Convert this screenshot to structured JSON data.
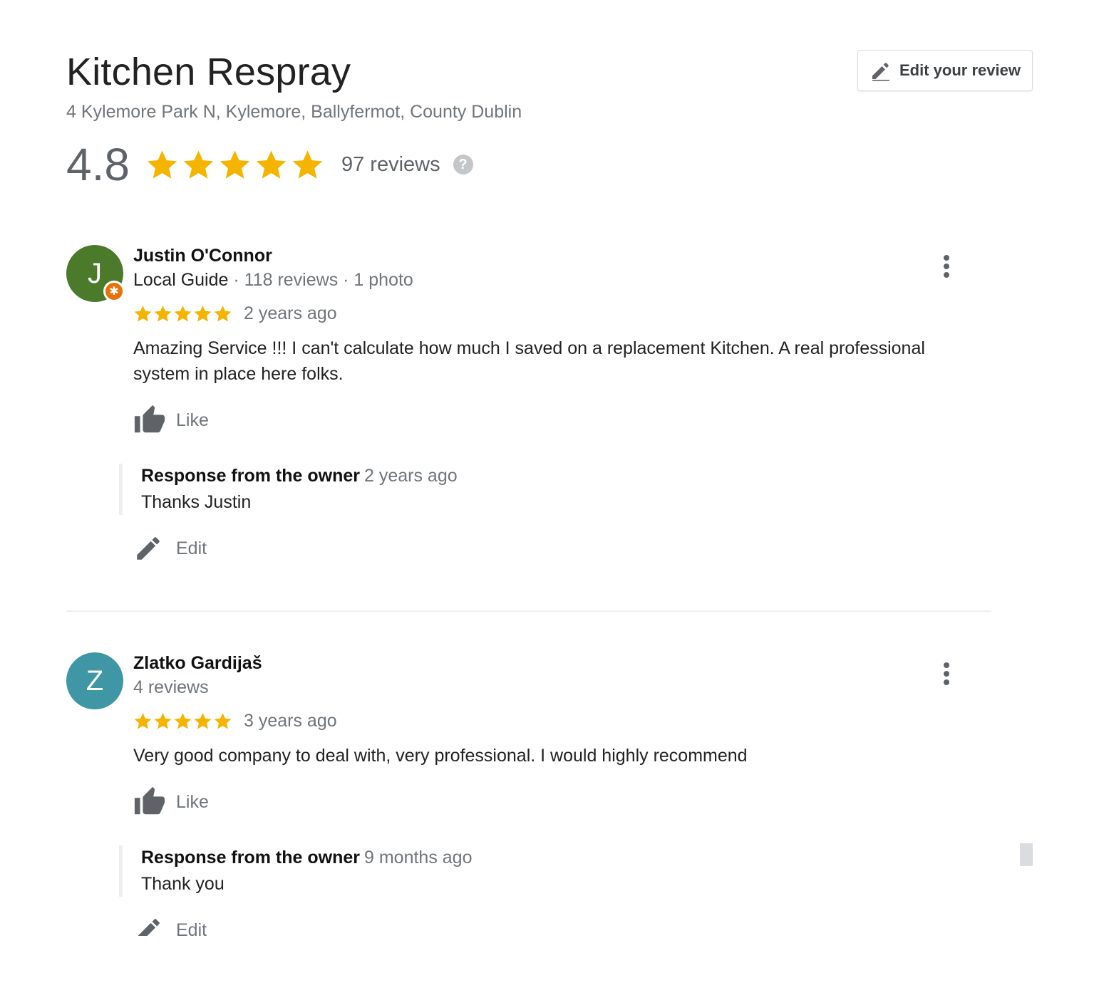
{
  "place": {
    "name": "Kitchen Respray",
    "address": "4 Kylemore Park N, Kylemore, Ballyfermot, County Dublin",
    "rating": "4.8",
    "rating_stars": 5,
    "review_count": "97 reviews",
    "help_icon": "?"
  },
  "edit_review_button": {
    "label": "Edit your review",
    "icon": "pencil-icon"
  },
  "colors": {
    "star": "#f4b400",
    "avatar_justin": "#4b7a2a",
    "avatar_zlatko": "#3f97a5",
    "badge": "#e8710a"
  },
  "reviews": [
    {
      "author": "Justin O'Connor",
      "avatar_letter": "J",
      "local_guide": "Local Guide",
      "meta_sep1": " · ",
      "review_count": "118 reviews",
      "meta_sep2": " · ",
      "photos": "1 photo",
      "stars": 5,
      "time": "2 years ago",
      "text": "Amazing Service !!!  I can't calculate how much I saved on a replacement Kitchen. A real professional system in place here folks.",
      "like_label": "Like",
      "response": {
        "title": "Response from the owner",
        "time": "2 years ago",
        "text": "Thanks Justin"
      },
      "edit_label": "Edit"
    },
    {
      "author": "Zlatko Gardijaš",
      "avatar_letter": "Z",
      "review_count": "4 reviews",
      "stars": 5,
      "time": "3 years ago",
      "text": "Very good company to deal with, very professional. I would highly recommend",
      "like_label": "Like",
      "response": {
        "title": "Response from the owner",
        "time": "9 months ago",
        "text": "Thank you"
      },
      "edit_label": "Edit"
    }
  ]
}
